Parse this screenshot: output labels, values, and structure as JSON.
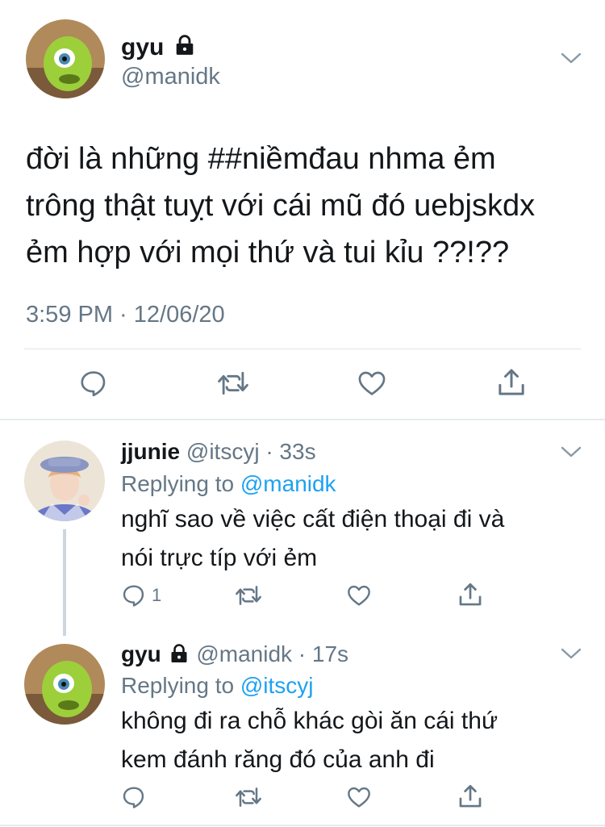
{
  "main_tweet": {
    "display_name": "gyu",
    "handle": "@manidk",
    "text_lines": [
      "đời là những ##niềmđau nhma ẻm",
      "trông thật tuỵt với cái mũ đó uebjskdx",
      "ẻm hợp với mọi thứ và tui kỉu ??!??"
    ],
    "timestamp": "3:59 PM · 12/06/20"
  },
  "reply1": {
    "display_name": "jjunie",
    "handle_time": "@itscyj · 33s",
    "replying_prefix": "Replying to",
    "replying_to": "@manidk",
    "text_lines": [
      "nghĩ sao về việc cất điện thoại đi và",
      "nói trực típ với ẻm"
    ],
    "reply_count": "1"
  },
  "reply2": {
    "display_name": "gyu",
    "handle_time": "@manidk · 17s",
    "replying_prefix": "Replying to",
    "replying_to": "@itscyj",
    "text_lines": [
      "không đi ra chỗ khác gòi ăn cái thứ",
      "kem đánh răng đó của anh đi"
    ]
  },
  "icons": [
    "lock-icon",
    "chevron-down-icon",
    "reply-icon",
    "retweet-icon",
    "like-icon",
    "share-icon"
  ],
  "colors": {
    "text": "#14171a",
    "muted": "#657786",
    "accent": "#1da1f2",
    "icon": "#657786"
  }
}
